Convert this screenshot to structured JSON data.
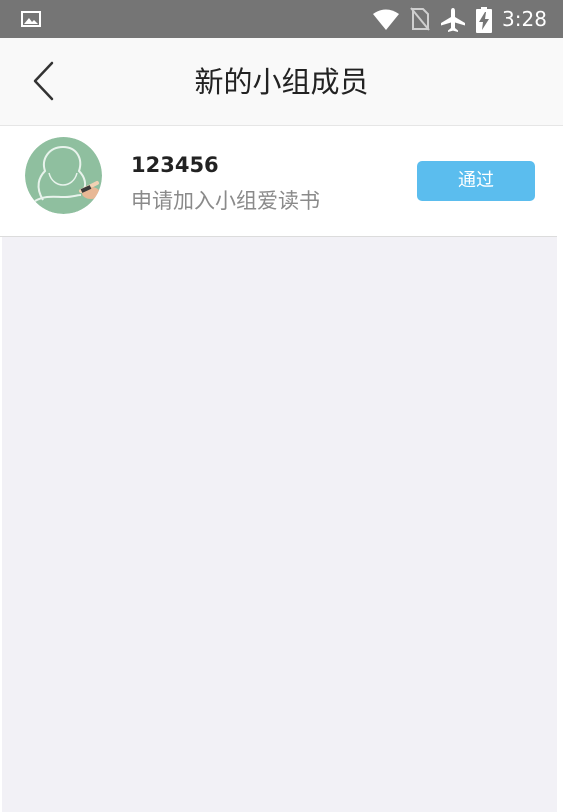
{
  "status_bar": {
    "time": "3:28",
    "icons": [
      "gallery-icon",
      "wifi-icon",
      "no-sim-icon",
      "airplane-icon",
      "battery-charging-icon"
    ]
  },
  "header": {
    "title": "新的小组成员",
    "back_icon": "chevron-left-icon"
  },
  "requests": [
    {
      "name": "123456",
      "message": "申请加入小组爱读书",
      "action_label": "通过"
    }
  ],
  "colors": {
    "status_bar": "#757575",
    "header_bg": "#f9f9f9",
    "page_bg": "#f2f1f6",
    "approve_button": "#5bbdee",
    "avatar_bg": "#8fbf9f"
  }
}
